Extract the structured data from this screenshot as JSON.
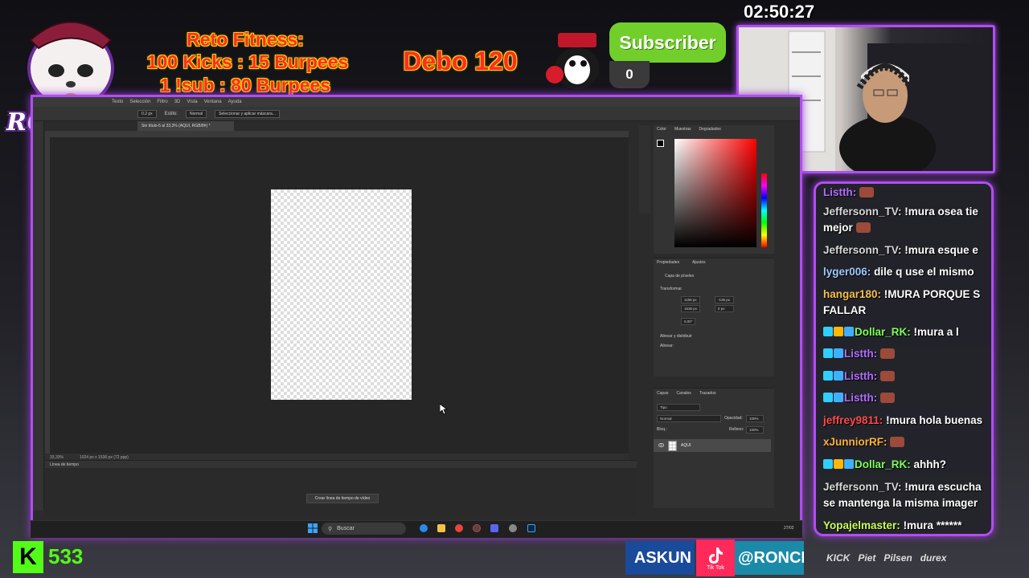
{
  "overlay": {
    "logo_text": "RONCHAS",
    "challenge": {
      "line1": "Reto Fitness:",
      "line2": "100 Kicks : 15 Burpees",
      "line3": "1 !sub : 80 Burpees"
    },
    "debo": "Debo 120",
    "subscriber_label": "Subscriber",
    "subscriber_count": "0",
    "timer": "02:50:27",
    "kick_viewers": "533",
    "askun": "ASKUN",
    "tiktok_label": "Tik Tok",
    "ronch": "@RONCH",
    "sponsors": [
      "KICK",
      "Piet",
      "Pilsen",
      "durex"
    ]
  },
  "photoshop": {
    "menu": [
      "Texto",
      "Selección",
      "Filtro",
      "3D",
      "Vista",
      "Ventana",
      "Ayuda"
    ],
    "options": {
      "size": "0.2 px",
      "style_label": "Estilo:",
      "style_value": "Normal",
      "select_mask": "Seleccionar y aplicar máscara..."
    },
    "doc_tab": "Sin título-5 al 33,3% (AQUI, RGB/8#) *",
    "status": {
      "zoom": "33,33%",
      "dims": "1024 px x 1536 px (72 ppp)"
    },
    "timeline_title": "Línea de tiempo",
    "timeline_button": "Crear línea de tiempo de vídeo",
    "color_tabs": [
      "Color",
      "Muestras",
      "Degradados"
    ],
    "props_tabs": [
      "Propiedades",
      "Ajustes"
    ],
    "props_pixel_layer": "Capa de píxeles",
    "props_transform": "Transformar",
    "props_w": "1168 px",
    "props_h": "1536 px",
    "props_x": "-136 px",
    "props_y": "0 px",
    "props_angle": "0,00°",
    "props_align": "Alinear y distribuir",
    "props_alinear": "Alinear:",
    "layers_tabs": [
      "Capas",
      "Canales",
      "Trazados"
    ],
    "layers_kind": "Tipo",
    "layers_mode": "Normal",
    "layers_opacity_label": "Opacidad:",
    "layers_opacity": "100%",
    "layers_lock_label": "Bloq.:",
    "layers_fill_label": "Relleno:",
    "layers_fill": "100%",
    "layer_name": "AQUI"
  },
  "taskbar": {
    "search_placeholder": "Buscar",
    "date": "27/02"
  },
  "chat": [
    {
      "user": "Listth:",
      "color": "#b06cff",
      "text": ""
    },
    {
      "user": "Jeffersonn_TV:",
      "color": "#d8d8d8",
      "text": "!mura osea tie mejor"
    },
    {
      "user": "Jeffersonn_TV:",
      "color": "#d8d8d8",
      "text": "!mura esque e"
    },
    {
      "user": "lyger006:",
      "color": "#9ec9ff",
      "text": "dile q use el mismo"
    },
    {
      "user": "hangar180:",
      "color": "#f5c04a",
      "text": "!MURA PORQUE S FALLAR"
    },
    {
      "user": "Dollar_RK:",
      "color": "#7cff5a",
      "text": "!mura a l"
    },
    {
      "user": "Listth:",
      "color": "#b06cff",
      "text": ""
    },
    {
      "user": "Listth:",
      "color": "#b06cff",
      "text": ""
    },
    {
      "user": "Listth:",
      "color": "#b06cff",
      "text": ""
    },
    {
      "user": "jeffrey9811:",
      "color": "#ff4a4a",
      "text": "!mura hola buenas"
    },
    {
      "user": "xJunniorRF:",
      "color": "#ffb23a",
      "text": ""
    },
    {
      "user": "Dollar_RK:",
      "color": "#7cff5a",
      "text": "ahhh?"
    },
    {
      "user": "Jeffersonn_TV:",
      "color": "#d8d8d8",
      "text": "!mura escucha se mantenga la misma imager"
    },
    {
      "user": "Yopajelmaster:",
      "color": "#c8ff5a",
      "text": "!mura ******"
    }
  ],
  "colors": {
    "accent_purple": "#b04ef0",
    "kick_green": "#53fc18",
    "challenge_red": "#ff2b2b"
  }
}
